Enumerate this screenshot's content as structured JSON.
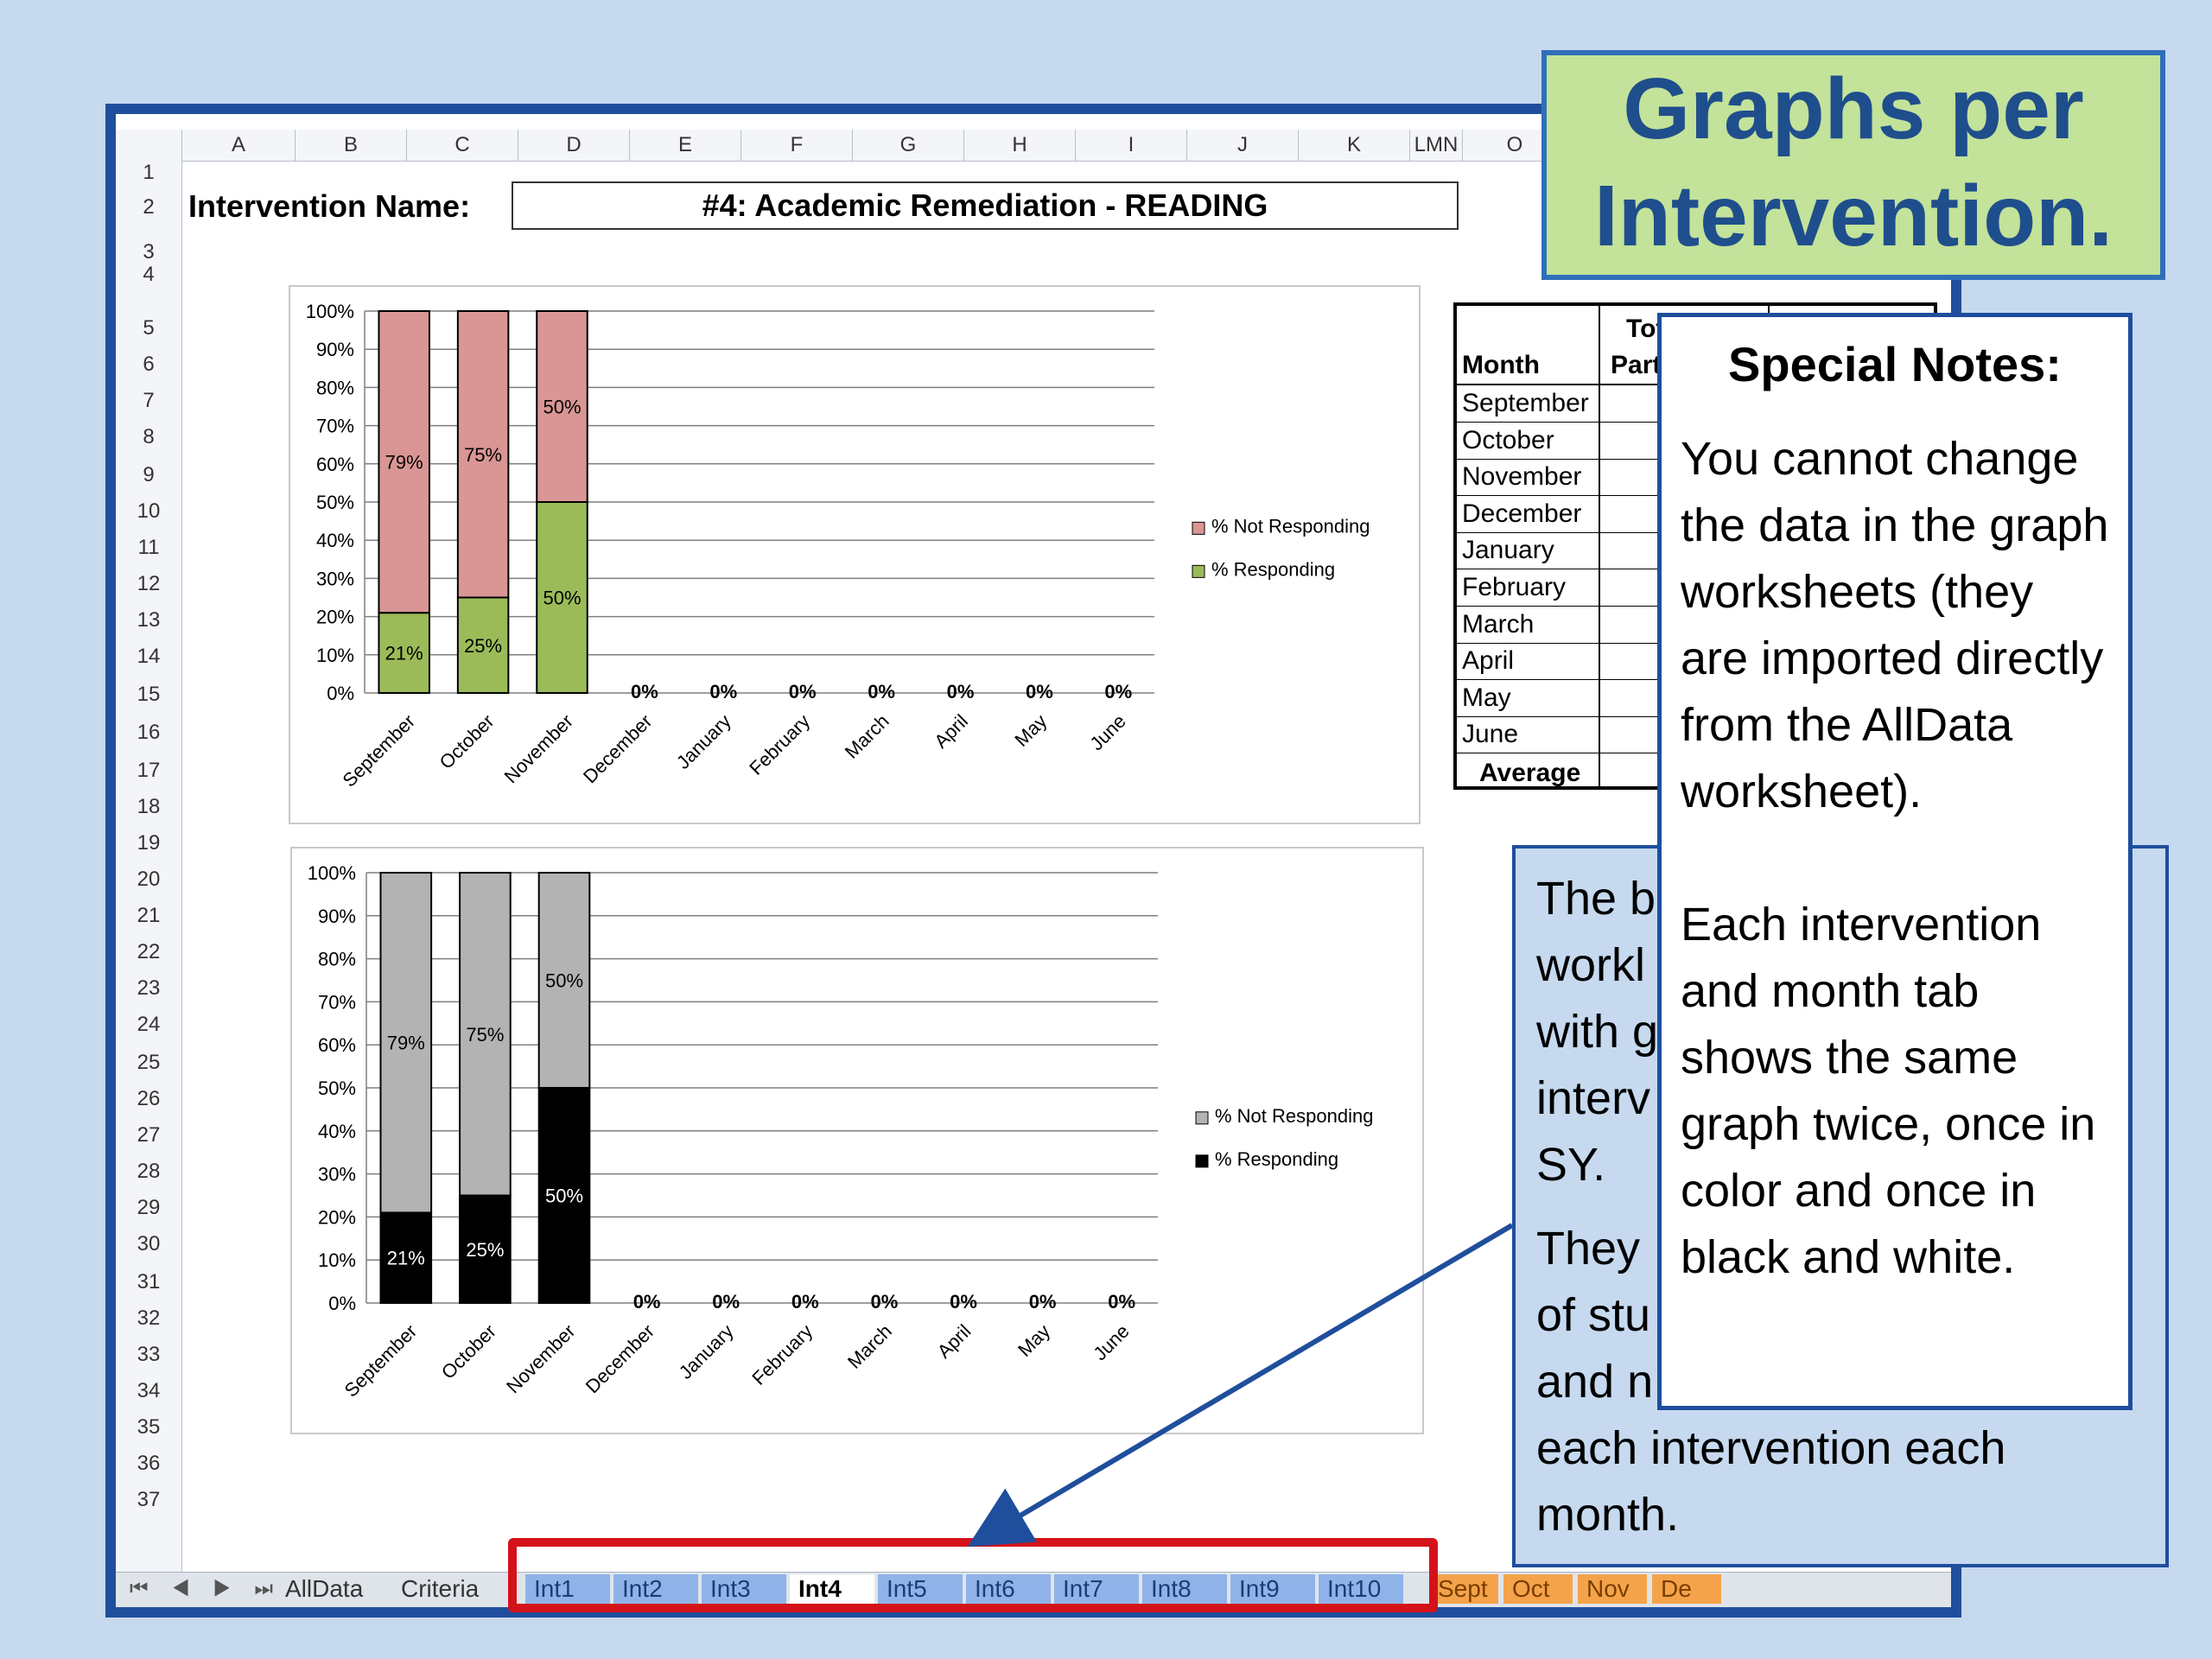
{
  "title": "Graphs per Intervention.",
  "columns": [
    "A",
    "B",
    "C",
    "D",
    "E",
    "F",
    "G",
    "H",
    "I",
    "J",
    "K",
    "LMN",
    "O"
  ],
  "rows": [
    "1",
    "2",
    "3",
    "4",
    "5",
    "6",
    "7",
    "8",
    "9",
    "10",
    "11",
    "12",
    "13",
    "14",
    "15",
    "16",
    "17",
    "18",
    "19",
    "20",
    "21",
    "22",
    "23",
    "24",
    "25",
    "26",
    "27",
    "28",
    "29",
    "30",
    "31",
    "32",
    "33",
    "34",
    "35",
    "36",
    "37"
  ],
  "intervention": {
    "label": "Intervention Name:",
    "value": "#4: Academic Remediation - READING"
  },
  "chart_data": [
    {
      "type": "bar",
      "stacked": true,
      "categories": [
        "September",
        "October",
        "November",
        "December",
        "January",
        "February",
        "March",
        "April",
        "May",
        "June"
      ],
      "series": [
        {
          "name": "% Responding",
          "values": [
            21,
            25,
            50,
            0,
            0,
            0,
            0,
            0,
            0,
            0
          ],
          "color": "#9bbb59"
        },
        {
          "name": "% Not Responding",
          "values": [
            79,
            75,
            50,
            0,
            0,
            0,
            0,
            0,
            0,
            0
          ],
          "color": "#d99694"
        }
      ],
      "yticks": [
        "0%",
        "10%",
        "20%",
        "30%",
        "40%",
        "50%",
        "60%",
        "70%",
        "80%",
        "90%",
        "100%"
      ],
      "ylim": [
        0,
        100
      ],
      "legend": "right",
      "grid": true
    },
    {
      "type": "bar",
      "stacked": true,
      "categories": [
        "September",
        "October",
        "November",
        "December",
        "January",
        "February",
        "March",
        "April",
        "May",
        "June"
      ],
      "series": [
        {
          "name": "% Responding",
          "values": [
            21,
            25,
            50,
            0,
            0,
            0,
            0,
            0,
            0,
            0
          ],
          "color": "#000000"
        },
        {
          "name": "% Not Responding",
          "values": [
            79,
            75,
            50,
            0,
            0,
            0,
            0,
            0,
            0,
            0
          ],
          "color": "#b3b3b3"
        }
      ],
      "yticks": [
        "0%",
        "10%",
        "20%",
        "30%",
        "40%",
        "50%",
        "60%",
        "70%",
        "80%",
        "90%",
        "100%"
      ],
      "ylim": [
        0,
        100
      ],
      "legend": "right",
      "grid": true
    }
  ],
  "month_table": {
    "header_month": "Month",
    "header_col2_line1": "Tot",
    "header_col2_line2": "Parti",
    "months": [
      "September",
      "October",
      "November",
      "December",
      "January",
      "February",
      "March",
      "April",
      "May",
      "June"
    ],
    "footer": "Average"
  },
  "sheet_tabs": {
    "nav": "⏮ ◀ ▶ ⏭",
    "plain": [
      "AllData",
      "Criteria"
    ],
    "interventions": [
      "Int1",
      "Int2",
      "Int3",
      "Int4",
      "Int5",
      "Int6",
      "Int7",
      "Int8",
      "Int9",
      "Int10"
    ],
    "active": "Int4",
    "months": [
      "Sept",
      "Oct",
      "Nov",
      "De"
    ]
  },
  "blue_box_text": [
    "The b",
    "workl",
    "with g",
    "interv",
    "SY.",
    "They",
    "of stu",
    "and n",
    "each intervention each",
    "month."
  ],
  "notes": {
    "title": "Special Notes:",
    "para1": "You cannot change the data in the graph worksheets (they are imported directly from the AllData worksheet).",
    "para2": "Each intervention and month tab shows the same graph twice, once in color and once in black and white."
  }
}
